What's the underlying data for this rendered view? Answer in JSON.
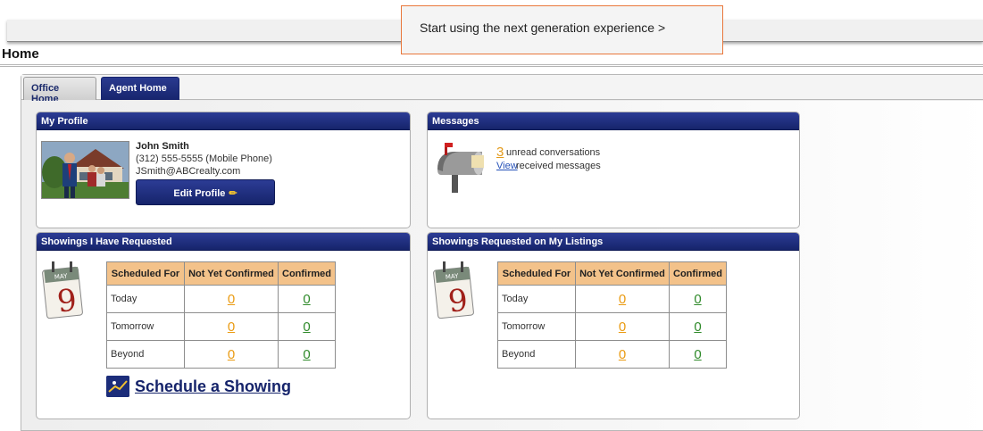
{
  "banner": {
    "next_gen_link": "Start using the next generation experience >"
  },
  "page": {
    "title": "Home"
  },
  "tabs": [
    {
      "label": "Office Home",
      "active": false
    },
    {
      "label": "Agent Home",
      "active": true
    }
  ],
  "profile": {
    "header": "My Profile",
    "name": "John Smith",
    "phone": "(312) 555-5555 (Mobile Phone)",
    "email": "JSmith@ABCrealty.com",
    "edit_button": "Edit Profile"
  },
  "messages": {
    "header": "Messages",
    "unread_count": "3",
    "unread_text": "unread conversations",
    "view_link": "View",
    "view_rest": "received messages"
  },
  "showings_requested": {
    "header": "Showings I Have Requested",
    "columns": [
      "Scheduled For",
      "Not Yet Confirmed",
      "Confirmed"
    ],
    "rows": [
      {
        "label": "Today",
        "not_confirmed": "0",
        "confirmed": "0"
      },
      {
        "label": "Tomorrow",
        "not_confirmed": "0",
        "confirmed": "0"
      },
      {
        "label": "Beyond",
        "not_confirmed": "0",
        "confirmed": "0"
      }
    ],
    "schedule_link": "Schedule a Showing"
  },
  "showings_listings": {
    "header": "Showings Requested on My Listings",
    "columns": [
      "Scheduled For",
      "Not Yet Confirmed",
      "Confirmed"
    ],
    "rows": [
      {
        "label": "Today",
        "not_confirmed": "0",
        "confirmed": "0"
      },
      {
        "label": "Tomorrow",
        "not_confirmed": "0",
        "confirmed": "0"
      },
      {
        "label": "Beyond",
        "not_confirmed": "0",
        "confirmed": "0"
      }
    ]
  },
  "icons": {
    "calendar_month": "MAY",
    "calendar_day": "9"
  },
  "colors": {
    "panel_header": "#1f2f80",
    "table_header": "#f3c28a",
    "not_confirmed": "#ea9b12",
    "confirmed": "#2f8a2a",
    "banner_border": "#e9773b"
  }
}
